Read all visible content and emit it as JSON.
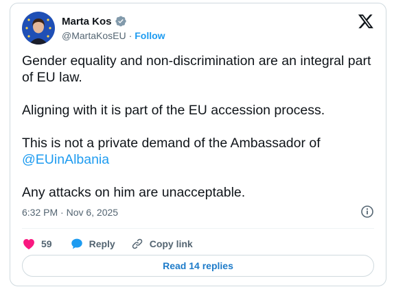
{
  "author": {
    "name": "Marta Kos",
    "handle": "@MartaKosEU",
    "separator": "·",
    "follow_label": "Follow",
    "verified": true
  },
  "platform_icon": "x-logo-icon",
  "tweet": {
    "paragraph_1": "Gender equality and non-discrimination are an integral part of EU law.",
    "paragraph_2": "Aligning with it is part of the EU accession process.",
    "paragraph_3_text": "This is not a private demand of the Ambassador of",
    "paragraph_3_mention": "@EUinAlbania",
    "paragraph_4": "Any attacks on him are unacceptable."
  },
  "timestamp": "6:32 PM · Nov 6, 2025",
  "actions": {
    "like_count": "59",
    "reply_label": "Reply",
    "copy_link_label": "Copy link"
  },
  "read_replies_label": "Read 14 replies",
  "colors": {
    "accent": "#1d9bf0",
    "like": "#f91880",
    "text": "#0f1419",
    "muted": "#536471",
    "border": "#cfd9de"
  }
}
